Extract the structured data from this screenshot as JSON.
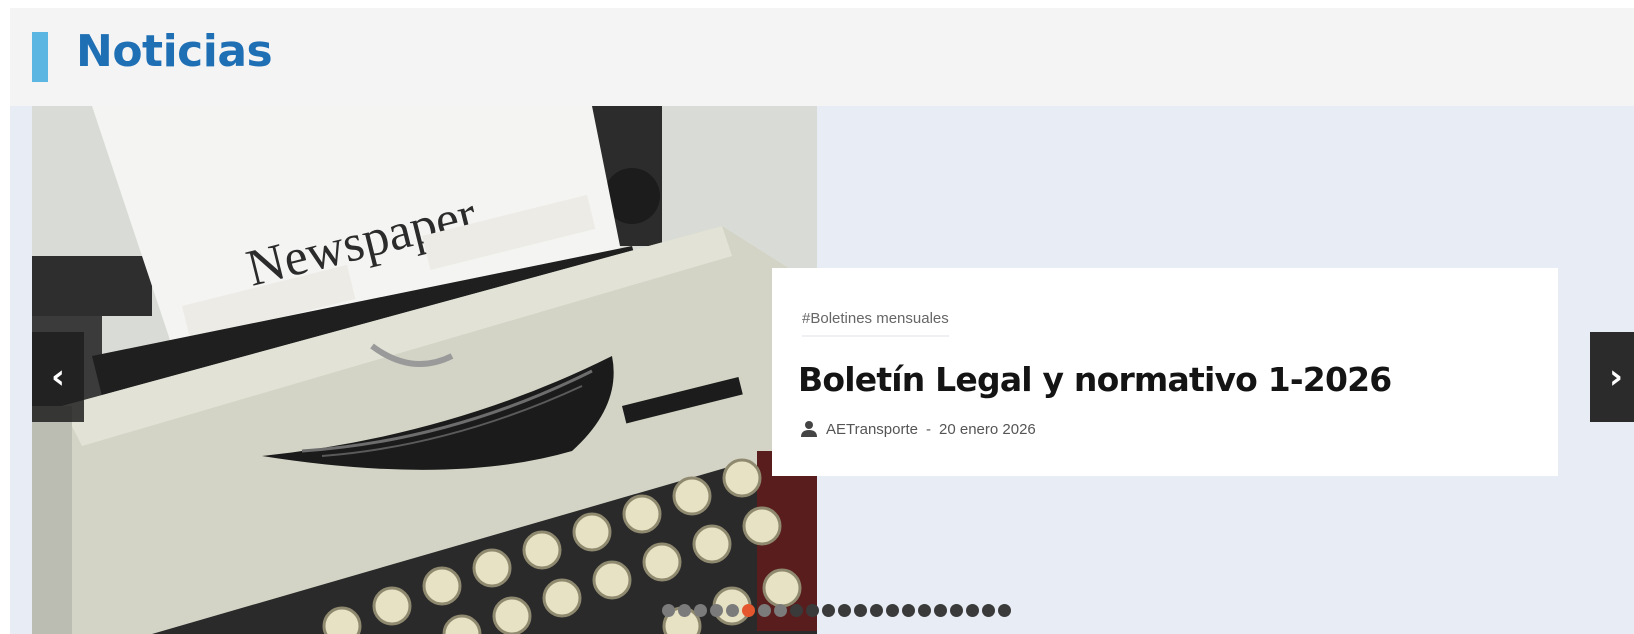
{
  "section": {
    "title": "Noticias"
  },
  "slide": {
    "image_text": "Newspaper",
    "tag": "#Boletines mensuales",
    "title": "Boletín Legal y normativo 1-2026",
    "author": "AETransporte",
    "separator": "-",
    "date": "20 enero 2026"
  },
  "navigation": {
    "prev_icon": "‹",
    "next_icon": "›"
  },
  "pager": {
    "total": 22,
    "active_index": 5
  },
  "colors": {
    "accent_bar": "#5bb6e2",
    "title_blue": "#1f6fb5",
    "active_dot": "#e4572e",
    "slider_bg": "#e8ecf5"
  }
}
